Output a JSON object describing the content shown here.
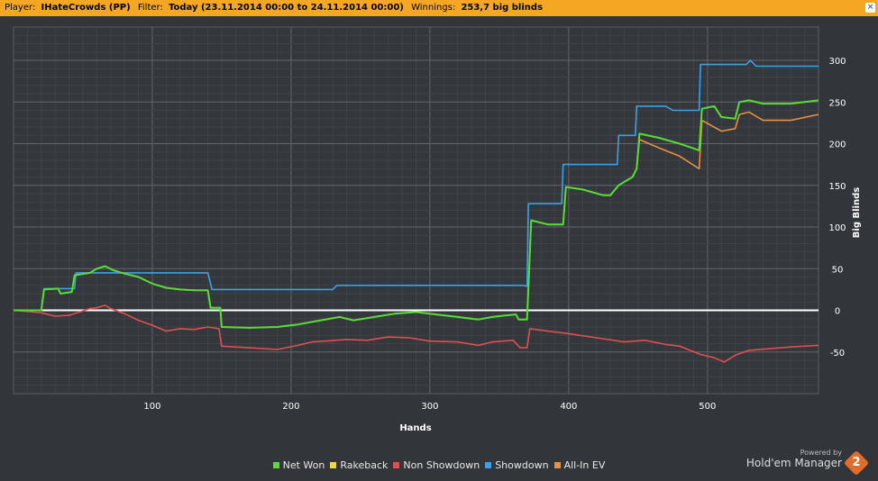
{
  "header": {
    "player_label": "Player:",
    "player_value": "IHateCrowds (PP)",
    "filter_label": "Filter:",
    "filter_value": "Today (23.11.2014 00:00 to 24.11.2014 00:00)",
    "winnings_label": "Winnings:",
    "winnings_value": "253,7 big blinds",
    "close_icon": "close-icon"
  },
  "branding": {
    "powered_by": "Powered by",
    "product": "Hold'em Manager",
    "logo_text": "2"
  },
  "chart_data": {
    "type": "line",
    "xlabel": "Hands",
    "ylabel": "Big Blinds",
    "xlim": [
      0,
      580
    ],
    "ylim": [
      -100,
      340
    ],
    "x_ticks": [
      100,
      200,
      300,
      400,
      500
    ],
    "y_ticks": [
      300,
      250,
      200,
      150,
      100,
      50,
      0,
      -50
    ],
    "grid": true,
    "legend_position": "bottom",
    "series": [
      {
        "name": "Net Won",
        "color": "#55dd33",
        "points": [
          [
            0,
            0
          ],
          [
            20,
            0
          ],
          [
            22,
            25
          ],
          [
            32,
            26
          ],
          [
            34,
            20
          ],
          [
            42,
            22
          ],
          [
            44,
            42
          ],
          [
            55,
            45
          ],
          [
            60,
            50
          ],
          [
            66,
            53
          ],
          [
            72,
            48
          ],
          [
            80,
            44
          ],
          [
            90,
            40
          ],
          [
            100,
            32
          ],
          [
            110,
            27
          ],
          [
            120,
            25
          ],
          [
            130,
            24
          ],
          [
            140,
            24
          ],
          [
            142,
            3
          ],
          [
            149,
            3
          ],
          [
            150,
            -20
          ],
          [
            170,
            -21
          ],
          [
            190,
            -20
          ],
          [
            205,
            -17
          ],
          [
            215,
            -14
          ],
          [
            235,
            -8
          ],
          [
            245,
            -12
          ],
          [
            260,
            -8
          ],
          [
            275,
            -4
          ],
          [
            290,
            -2
          ],
          [
            310,
            -6
          ],
          [
            320,
            -8
          ],
          [
            335,
            -11
          ],
          [
            345,
            -8
          ],
          [
            355,
            -6
          ],
          [
            362,
            -5
          ],
          [
            364,
            -11
          ],
          [
            370,
            -11
          ],
          [
            373,
            108
          ],
          [
            385,
            103
          ],
          [
            396,
            103
          ],
          [
            398,
            148
          ],
          [
            410,
            145
          ],
          [
            425,
            138
          ],
          [
            430,
            138
          ],
          [
            436,
            150
          ],
          [
            446,
            160
          ],
          [
            449,
            170
          ],
          [
            451,
            212
          ],
          [
            465,
            207
          ],
          [
            480,
            200
          ],
          [
            494,
            192
          ],
          [
            496,
            242
          ],
          [
            505,
            245
          ],
          [
            510,
            232
          ],
          [
            520,
            230
          ],
          [
            523,
            250
          ],
          [
            530,
            252
          ],
          [
            540,
            248
          ],
          [
            560,
            248
          ],
          [
            580,
            252
          ]
        ]
      },
      {
        "name": "Rakeback",
        "color": "#e8d848",
        "points": [
          [
            0,
            0
          ],
          [
            580,
            0
          ]
        ]
      },
      {
        "name": "Non Showdown",
        "color": "#dd5050",
        "points": [
          [
            0,
            0
          ],
          [
            15,
            -2
          ],
          [
            20,
            -3
          ],
          [
            30,
            -7
          ],
          [
            40,
            -6
          ],
          [
            55,
            2
          ],
          [
            60,
            3
          ],
          [
            66,
            6
          ],
          [
            70,
            2
          ],
          [
            80,
            -4
          ],
          [
            90,
            -12
          ],
          [
            100,
            -18
          ],
          [
            110,
            -25
          ],
          [
            120,
            -22
          ],
          [
            130,
            -23
          ],
          [
            140,
            -20
          ],
          [
            148,
            -22
          ],
          [
            150,
            -43
          ],
          [
            170,
            -45
          ],
          [
            190,
            -47
          ],
          [
            205,
            -42
          ],
          [
            215,
            -38
          ],
          [
            225,
            -37
          ],
          [
            240,
            -35
          ],
          [
            255,
            -36
          ],
          [
            270,
            -32
          ],
          [
            285,
            -33
          ],
          [
            300,
            -37
          ],
          [
            320,
            -38
          ],
          [
            335,
            -42
          ],
          [
            345,
            -38
          ],
          [
            360,
            -36
          ],
          [
            365,
            -45
          ],
          [
            370,
            -45
          ],
          [
            372,
            -22
          ],
          [
            385,
            -25
          ],
          [
            400,
            -28
          ],
          [
            420,
            -33
          ],
          [
            440,
            -38
          ],
          [
            455,
            -36
          ],
          [
            470,
            -41
          ],
          [
            480,
            -43
          ],
          [
            495,
            -53
          ],
          [
            505,
            -57
          ],
          [
            512,
            -62
          ],
          [
            520,
            -54
          ],
          [
            530,
            -48
          ],
          [
            545,
            -46
          ],
          [
            560,
            -44
          ],
          [
            580,
            -42
          ]
        ]
      },
      {
        "name": "Showdown",
        "color": "#3fa0e0",
        "points": [
          [
            0,
            0
          ],
          [
            20,
            0
          ],
          [
            22,
            26
          ],
          [
            44,
            26
          ],
          [
            45,
            45
          ],
          [
            140,
            45
          ],
          [
            143,
            25
          ],
          [
            230,
            25
          ],
          [
            233,
            30
          ],
          [
            367,
            30
          ],
          [
            370,
            29
          ],
          [
            371,
            128
          ],
          [
            395,
            128
          ],
          [
            396,
            175
          ],
          [
            435,
            175
          ],
          [
            436,
            210
          ],
          [
            448,
            210
          ],
          [
            449,
            245
          ],
          [
            470,
            245
          ],
          [
            475,
            240
          ],
          [
            494,
            240
          ],
          [
            495,
            295
          ],
          [
            528,
            295
          ],
          [
            531,
            300
          ],
          [
            535,
            293
          ],
          [
            580,
            293
          ]
        ]
      },
      {
        "name": "All-In EV",
        "color": "#e89040",
        "points": [
          [
            0,
            0
          ],
          [
            20,
            0
          ],
          [
            22,
            25
          ],
          [
            32,
            26
          ],
          [
            34,
            20
          ],
          [
            42,
            22
          ],
          [
            44,
            42
          ],
          [
            55,
            45
          ],
          [
            60,
            50
          ],
          [
            66,
            53
          ],
          [
            72,
            48
          ],
          [
            80,
            44
          ],
          [
            90,
            40
          ],
          [
            100,
            32
          ],
          [
            110,
            27
          ],
          [
            120,
            25
          ],
          [
            130,
            24
          ],
          [
            140,
            24
          ],
          [
            142,
            3
          ],
          [
            149,
            3
          ],
          [
            150,
            -20
          ],
          [
            170,
            -21
          ],
          [
            190,
            -20
          ],
          [
            205,
            -17
          ],
          [
            215,
            -14
          ],
          [
            235,
            -8
          ],
          [
            245,
            -12
          ],
          [
            260,
            -8
          ],
          [
            275,
            -4
          ],
          [
            290,
            -2
          ],
          [
            310,
            -6
          ],
          [
            320,
            -8
          ],
          [
            335,
            -11
          ],
          [
            345,
            -8
          ],
          [
            355,
            -6
          ],
          [
            362,
            -5
          ],
          [
            364,
            -11
          ],
          [
            370,
            -11
          ],
          [
            373,
            108
          ],
          [
            385,
            103
          ],
          [
            396,
            103
          ],
          [
            398,
            148
          ],
          [
            410,
            145
          ],
          [
            425,
            138
          ],
          [
            430,
            138
          ],
          [
            436,
            150
          ],
          [
            446,
            160
          ],
          [
            449,
            170
          ],
          [
            451,
            205
          ],
          [
            465,
            195
          ],
          [
            480,
            185
          ],
          [
            494,
            170
          ],
          [
            496,
            228
          ],
          [
            510,
            215
          ],
          [
            520,
            218
          ],
          [
            523,
            235
          ],
          [
            530,
            238
          ],
          [
            540,
            228
          ],
          [
            560,
            228
          ],
          [
            580,
            235
          ]
        ]
      }
    ]
  }
}
